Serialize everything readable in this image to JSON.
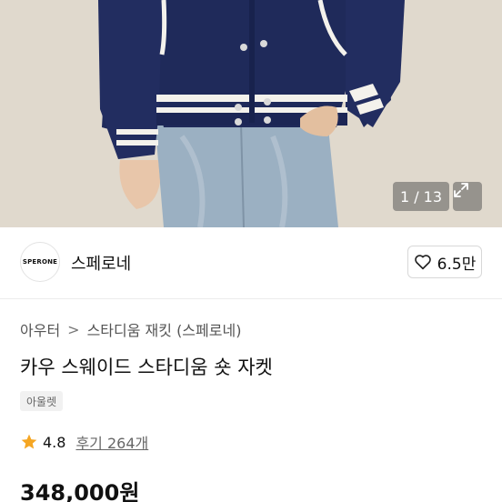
{
  "gallery": {
    "counter": "1 / 13",
    "expand_icon": "expand-icon"
  },
  "shop": {
    "logo_text": "SPERONE",
    "name": "스페로네",
    "like_count": "6.5만",
    "like_icon": "heart-outline-icon"
  },
  "breadcrumb": {
    "items": [
      "아우터",
      "스타디움 재킷 (스페로네)"
    ],
    "separator": ">"
  },
  "product": {
    "title": "카우 스웨이드 스타디움 숏 자켓",
    "tag": "아울렛",
    "rating": "4.8",
    "reviews": "후기 264개",
    "price": "348,000원"
  },
  "colors": {
    "jacket": "#1f2a5a",
    "star": "#f5a623"
  }
}
